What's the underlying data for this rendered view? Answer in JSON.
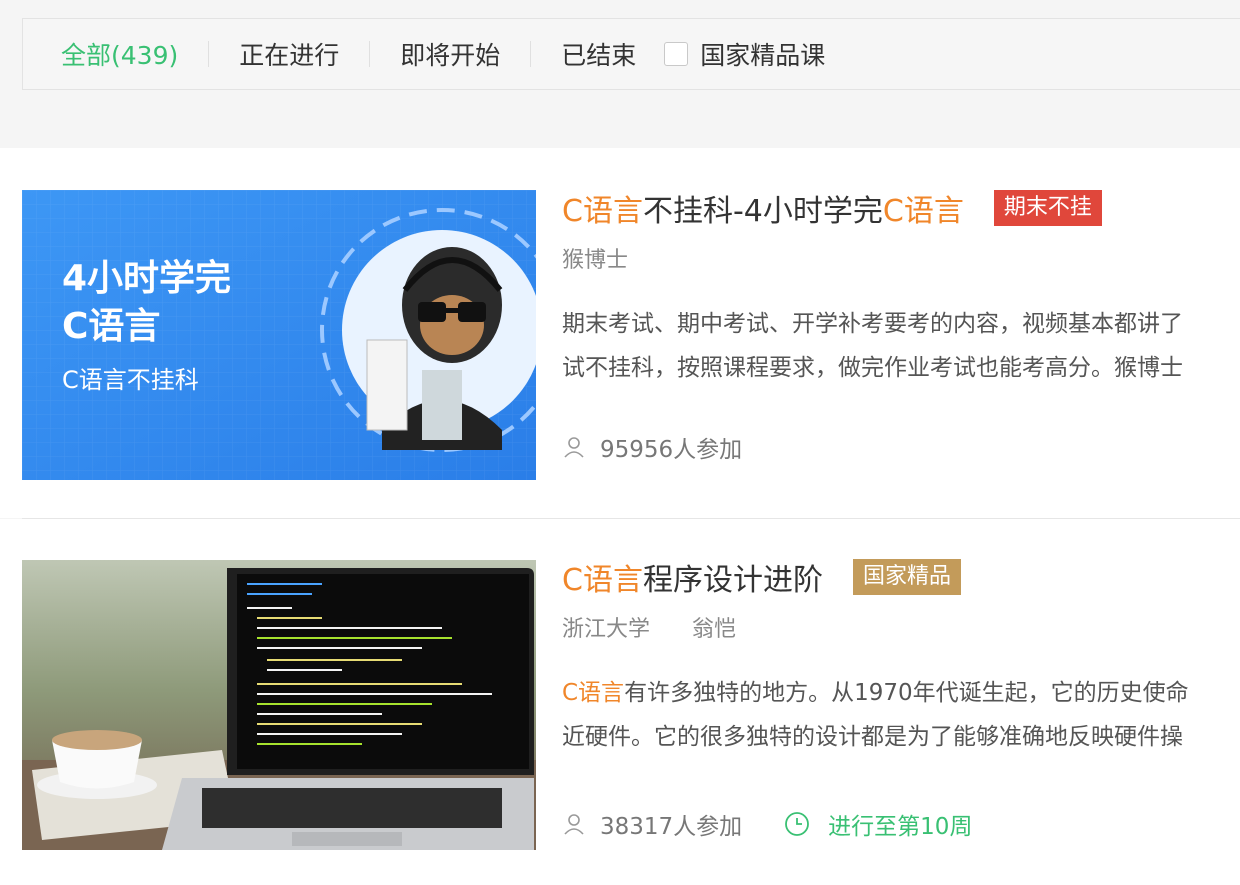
{
  "filters": {
    "all": "全部(439)",
    "ongoing": "正在进行",
    "upcoming": "即将开始",
    "ended": "已结束",
    "national_label": "国家精品课"
  },
  "courses": [
    {
      "title_hl1": "C语言",
      "title_mid": "不挂科-4小时学完",
      "title_hl2": "C语言",
      "badge": "期末不挂",
      "teacher": "猴博士",
      "desc_line1": "期末考试、期中考试、开学补考要考的内容，视频基本都讲了",
      "desc_line2": "试不挂科，按照课程要求，做完作业考试也能考高分。猴博士",
      "participants": "95956人参加",
      "thumb_line1": "4小时学完",
      "thumb_line2": "C语言",
      "thumb_line3": "C语言不挂科"
    },
    {
      "title_hl1": "C语言",
      "title_mid": "程序设计进阶",
      "badge": "国家精品",
      "school": "浙江大学",
      "teacher": "翁恺",
      "desc_hl": "C语言",
      "desc_line1": "有许多独特的地方。从1970年代诞生起，它的历史使命",
      "desc_line2": "近硬件。它的很多独特的设计都是为了能够准确地反映硬件操",
      "participants": "38317人参加",
      "progress": "进行至第10周"
    }
  ],
  "colors": {
    "accent_green": "#39c073",
    "highlight_orange": "#f0862a",
    "badge_red": "#e0473b",
    "badge_gold": "#c39b5a"
  },
  "icons": [
    "user-icon",
    "clock-icon"
  ]
}
